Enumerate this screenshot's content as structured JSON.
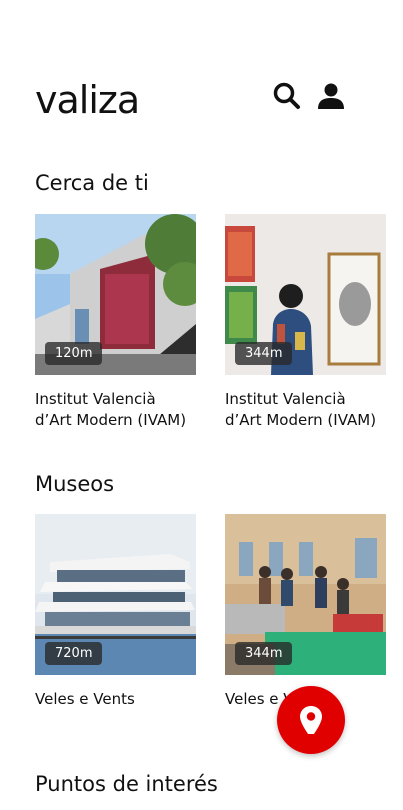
{
  "app": {
    "logo": "valiza"
  },
  "header": {
    "icons": [
      "search-icon",
      "user-icon"
    ]
  },
  "sections": [
    {
      "title": "Cerca de ti",
      "cards": [
        {
          "distance": "120m",
          "name": "Institut Valencià d’Art Modern (IVAM)"
        },
        {
          "distance": "344m",
          "name": "Institut Valencià d’Art Modern (IVAM)"
        }
      ]
    },
    {
      "title": "Museos",
      "cards": [
        {
          "distance": "720m",
          "name": "Veles e Vents"
        },
        {
          "distance": "344m",
          "name": "Veles e Vents"
        }
      ]
    },
    {
      "title": "Puntos de interés"
    }
  ],
  "fab": {
    "icon": "map-pin-icon",
    "color": "#e10000"
  }
}
